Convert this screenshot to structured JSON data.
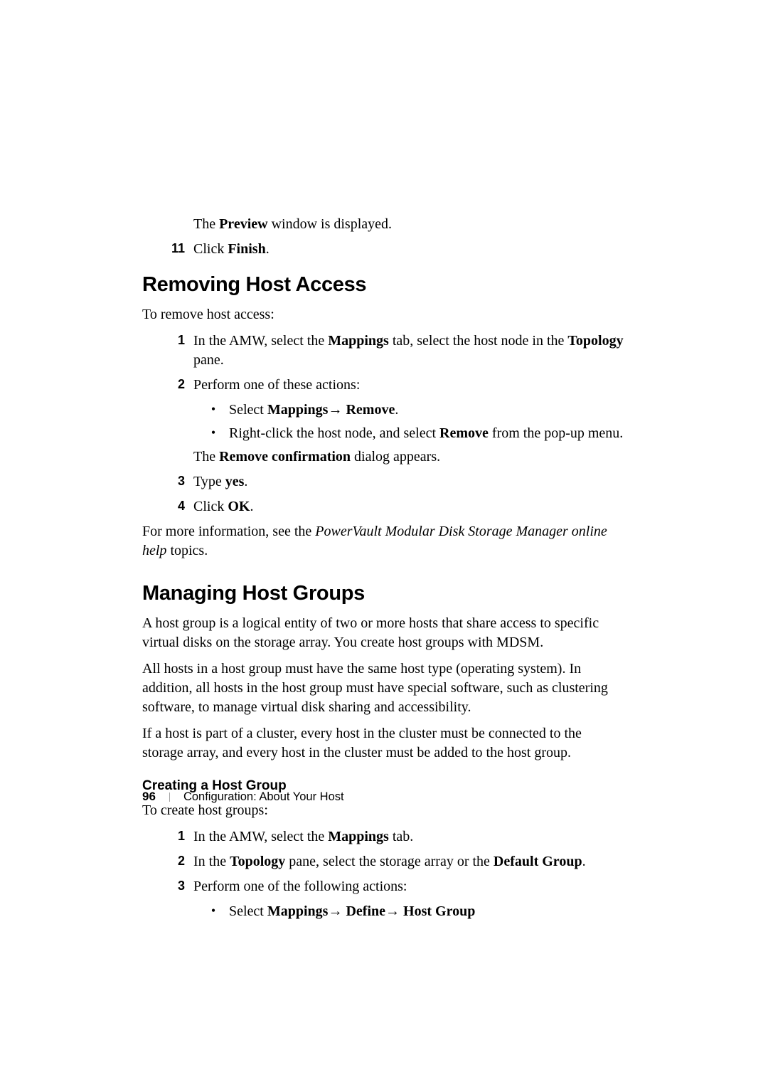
{
  "preview_line": {
    "pre": "The ",
    "bold": "Preview",
    "post": " window is displayed."
  },
  "step11": {
    "num": "11",
    "pre": "Click ",
    "bold": "Finish",
    "post": "."
  },
  "sec1": {
    "heading": "Removing Host Access",
    "intro": "To remove host access:",
    "step1": {
      "num": "1",
      "pre": "In the AMW, select the ",
      "b1": "Mappings",
      "mid1": " tab, select the host node in the ",
      "b2": "Topology",
      "post": " pane."
    },
    "step2": {
      "num": "2",
      "text": "Perform one of these actions:"
    },
    "bul1": {
      "pre": "Select ",
      "b1": "Mappings",
      "arrow": "→ ",
      "b2": "Remove",
      "post": "."
    },
    "bul2": {
      "pre": "Right-click the host node, and select ",
      "b1": "Remove",
      "post": " from the pop-up menu."
    },
    "confirm": {
      "pre": "The ",
      "b1": "Remove confirmation",
      "post": " dialog appears."
    },
    "step3": {
      "num": "3",
      "pre": "Type ",
      "b1": "yes",
      "post": "."
    },
    "step4": {
      "num": "4",
      "pre": "Click ",
      "b1": "OK",
      "post": "."
    },
    "more": {
      "pre": "For more information, see the ",
      "it": "PowerVault Modular Disk Storage Manager online help",
      "post": " topics."
    }
  },
  "sec2": {
    "heading": "Managing Host Groups",
    "p1": "A host group is a logical entity of two or more hosts that share access to specific virtual disks on the storage array. You create host groups with MDSM.",
    "p2": "All hosts in a host group must have the same host type (operating system). In addition, all hosts in the host group must have special software, such as clustering software, to manage virtual disk sharing and accessibility.",
    "p3": "If a host is part of a cluster, every host in the cluster must be connected to the storage array, and every host in the cluster must be added to the host group.",
    "sub_heading": "Creating a Host Group",
    "intro2": "To create host groups:",
    "step1": {
      "num": "1",
      "pre": "In the AMW, select the ",
      "b1": "Mappings",
      "post": " tab."
    },
    "step2": {
      "num": "2",
      "pre": "In the ",
      "b1": "Topology",
      "mid": " pane, select the storage array or the ",
      "b2": "Default Group",
      "post": "."
    },
    "step3": {
      "num": "3",
      "text": "Perform one of the following actions:"
    },
    "bul1": {
      "pre": "Select ",
      "b1": "Mappings",
      "a1": "→ ",
      "b2": "Define",
      "a2": "→ ",
      "b3": "Host Group"
    }
  },
  "footer": {
    "page": "96",
    "sep": "|",
    "text": "Configuration: About Your Host"
  }
}
